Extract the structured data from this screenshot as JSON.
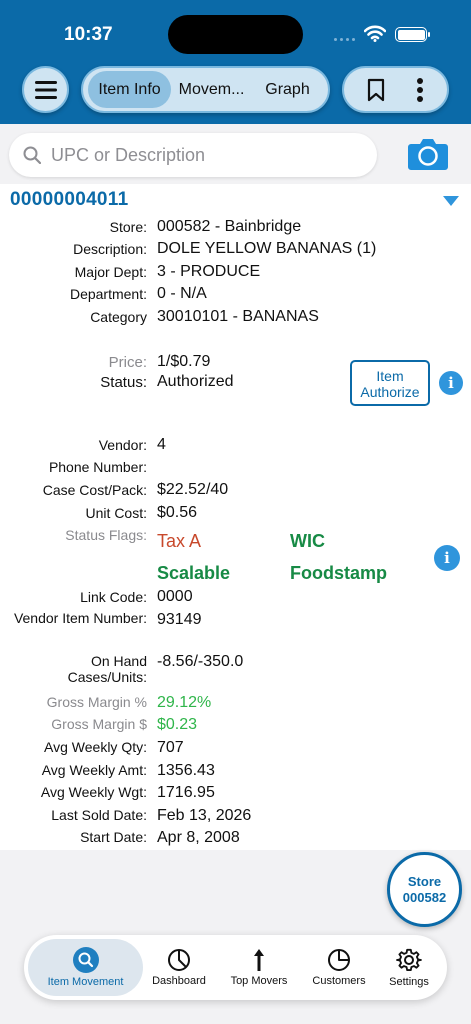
{
  "status_bar": {
    "time": "10:37"
  },
  "tabs": [
    {
      "label": "Item Info",
      "active": true
    },
    {
      "label": "Movem...",
      "active": false
    },
    {
      "label": "Graph",
      "active": false
    }
  ],
  "search": {
    "placeholder": "UPC or Description",
    "value": ""
  },
  "item": {
    "upc": "00000004011",
    "fields": {
      "store": {
        "label": "Store:",
        "value": "000582 - Bainbridge"
      },
      "description": {
        "label": "Description:",
        "value": "DOLE YELLOW BANANAS (1)"
      },
      "major_dept": {
        "label": "Major Dept:",
        "value": "3 - PRODUCE"
      },
      "department": {
        "label": "Department:",
        "value": "0 - N/A"
      },
      "category": {
        "label": "Category",
        "value": "30010101 - BANANAS"
      },
      "price": {
        "label": "Price:",
        "value": "1/$0.79"
      },
      "status": {
        "label": "Status:",
        "value": "Authorized"
      },
      "vendor": {
        "label": "Vendor:",
        "value": "4"
      },
      "phone": {
        "label": "Phone Number:",
        "value": ""
      },
      "case_cost": {
        "label": "Case Cost/Pack:",
        "value": "$22.52/40"
      },
      "unit_cost": {
        "label": "Unit Cost:",
        "value": "$0.56"
      },
      "status_flags": {
        "label": "Status Flags:"
      },
      "link_code": {
        "label": "Link Code:",
        "value": "0000"
      },
      "vendor_item": {
        "label": "Vendor Item Number:",
        "value": "93149"
      },
      "on_hand": {
        "label_1": "On Hand",
        "label_2": "Cases/Units:",
        "value": "-8.56/-350.0"
      },
      "gross_margin_pct": {
        "label": "Gross Margin %",
        "value": "29.12%"
      },
      "gross_margin_amt": {
        "label": "Gross Margin $",
        "value": "$0.23"
      },
      "avg_weekly_qty": {
        "label": "Avg Weekly Qty:",
        "value": "707"
      },
      "avg_weekly_amt": {
        "label": "Avg Weekly Amt:",
        "value": "1356.43"
      },
      "avg_weekly_wgt": {
        "label": "Avg Weekly Wgt:",
        "value": "1716.95"
      },
      "last_sold": {
        "label": "Last Sold Date:",
        "value": "Feb 13, 2026"
      },
      "start_date": {
        "label": "Start Date:",
        "value": "Apr 8, 2008"
      }
    },
    "flags": [
      "Tax A",
      "WIC",
      "Scalable",
      "Foodstamp"
    ],
    "authorize_button": {
      "line_1": "Item",
      "line_2": "Authorize"
    }
  },
  "store_button": {
    "line_1": "Store",
    "line_2": "000582"
  },
  "bottom_nav": [
    {
      "label": "Item Movement",
      "icon": "search-icon",
      "active": true
    },
    {
      "label": "Dashboard",
      "icon": "pie-chart-icon",
      "active": false
    },
    {
      "label": "Top Movers",
      "icon": "arrow-up-icon",
      "active": false
    },
    {
      "label": "Customers",
      "icon": "pie-chart-icon",
      "active": false
    },
    {
      "label": "Settings",
      "icon": "gear-icon",
      "active": false
    }
  ],
  "colors": {
    "brand": "#0b6aa8",
    "accent": "#2f95dc",
    "flag_red": "#c8492c",
    "flag_green": "#178a45",
    "margin_green": "#2fb54a"
  }
}
